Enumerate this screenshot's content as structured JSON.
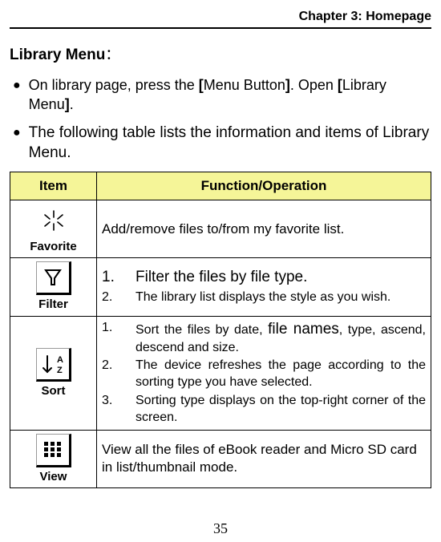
{
  "header": {
    "chapter": "Chapter 3: Homepage"
  },
  "title": {
    "text": "Library Menu",
    "colon": "："
  },
  "bullets": [
    {
      "pre": "On library page, press the ",
      "bold1": "[",
      "mid1": "Menu Button",
      "bold2": "]",
      "mid2": ". Open ",
      "bold3": "[",
      "mid3": "Library Menu",
      "bold4": "]",
      "post": "."
    },
    {
      "text": "The following table lists the information and items of Library Menu."
    }
  ],
  "table": {
    "headers": {
      "item": "Item",
      "func": "Function/Operation"
    },
    "rows": {
      "favorite": {
        "item_label": "Favorite",
        "icon": "sparkle-icon",
        "op_text": "Add/remove files to/from my favorite list."
      },
      "filter": {
        "item_label": "Filter",
        "icon": "filter-icon",
        "ops": [
          {
            "n": "1.",
            "t": "Filter the files by file type.",
            "cls": "big"
          },
          {
            "n": "2.",
            "t": "The library list displays the style as you wish.",
            "cls": "small"
          }
        ]
      },
      "sort": {
        "item_label": "Sort",
        "icon": "sort-az-icon",
        "ops": [
          {
            "n": "1.",
            "t_pre": "Sort the files by date, ",
            "t_big": "file names",
            "t_post": ", type, ascend, descend and size."
          },
          {
            "n": "2.",
            "t": "The device refreshes the page according to the sorting type you have selected."
          },
          {
            "n": "3.",
            "t": "Sorting type displays on the top-right corner of the screen."
          }
        ]
      },
      "view": {
        "item_label": "View",
        "icon": "grid-icon",
        "op_text": "View all the files of eBook reader and Micro SD card in list/thumbnail mode."
      }
    }
  },
  "page_number": "35"
}
